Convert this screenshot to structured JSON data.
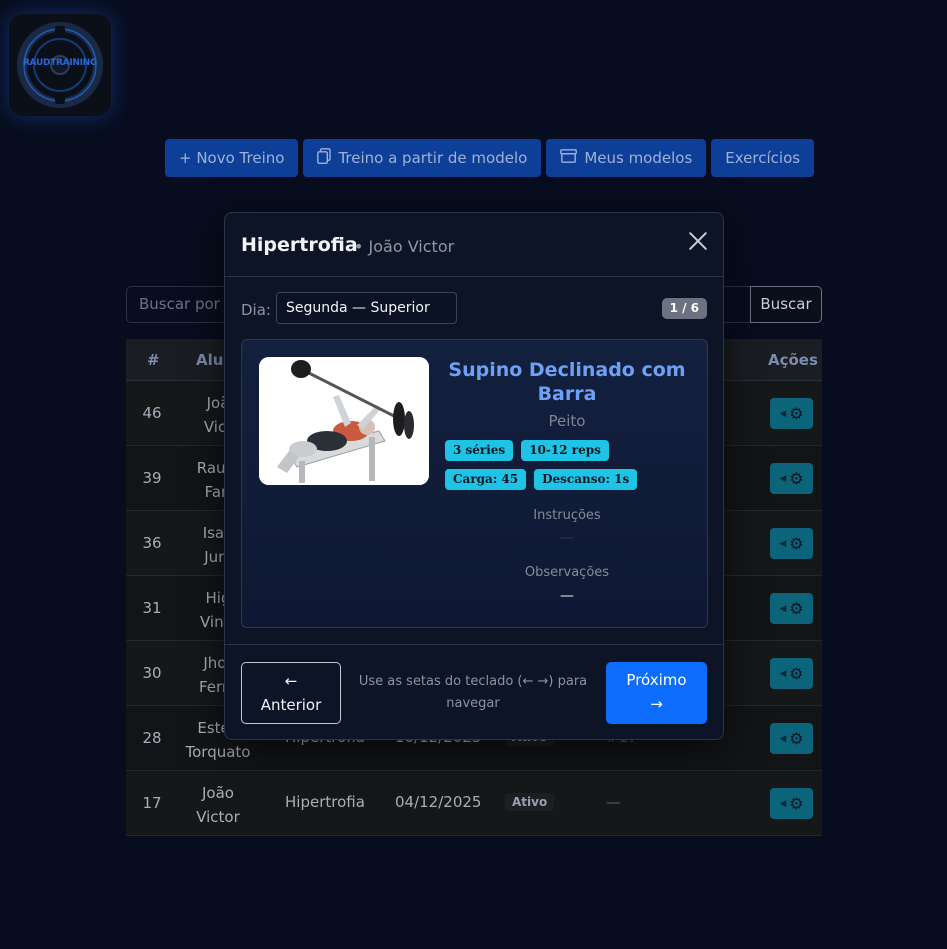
{
  "logo": {
    "text": "RAUDTRAINING"
  },
  "toolbar": {
    "new_label": "+ Novo Treino",
    "from_model_label": "Treino a partir de modelo",
    "models_label": "Meus modelos",
    "exercises_label": "Exercícios"
  },
  "search": {
    "placeholder": "Buscar por a",
    "button_label": "Buscar"
  },
  "table": {
    "headers": {
      "id": "#",
      "name": "Alun",
      "actions": "Ações"
    },
    "rows": [
      {
        "id": "46",
        "name1": "Joã",
        "name2": "Vict",
        "tipo": "",
        "date": "",
        "status": "",
        "dash": ""
      },
      {
        "id": "39",
        "name1": "Raudi",
        "name2": "Fari",
        "tipo": "",
        "date": "",
        "status": "",
        "dash": ""
      },
      {
        "id": "36",
        "name1": "Isaa",
        "name2": "Juni",
        "tipo": "",
        "date": "",
        "status": "",
        "dash": ""
      },
      {
        "id": "31",
        "name1": "Hig",
        "name2": "Vinic",
        "tipo": "",
        "date": "",
        "status": "",
        "dash": ""
      },
      {
        "id": "30",
        "name1": "Jhor",
        "name2": "Ferre",
        "tipo": "",
        "date": "",
        "status": "",
        "dash": ""
      },
      {
        "id": "28",
        "name1": "Estev",
        "name2": "Torquato",
        "tipo": "Hipertrofia",
        "date": "10/12/2025",
        "status": "Ativo",
        "dash": "#17"
      },
      {
        "id": "17",
        "name1": "João",
        "name2": "Victor",
        "tipo": "Hipertrofia",
        "date": "04/12/2025",
        "status": "Ativo",
        "dash": "—"
      }
    ]
  },
  "modal": {
    "title": "Hipertrofia",
    "subtitle": "• João Victor",
    "day_label": "Dia:",
    "day_value": "Segunda — Superior",
    "counter": "1 / 6",
    "exercise": {
      "title": "Supino Declinado com Barra",
      "group": "Peito",
      "badges": [
        "3 séries",
        "10-12 reps",
        "Carga: 45",
        "Descanso: 1s"
      ],
      "instructions_label": "Instruções",
      "instructions_value": "—",
      "observations_label": "Observações",
      "observations_value": "—"
    },
    "prev_arrow": "←",
    "prev_label": "Anterior",
    "hint": "Use as setas do teclado (← →) para navegar",
    "next_label": "Próximo",
    "next_arrow": "→"
  }
}
